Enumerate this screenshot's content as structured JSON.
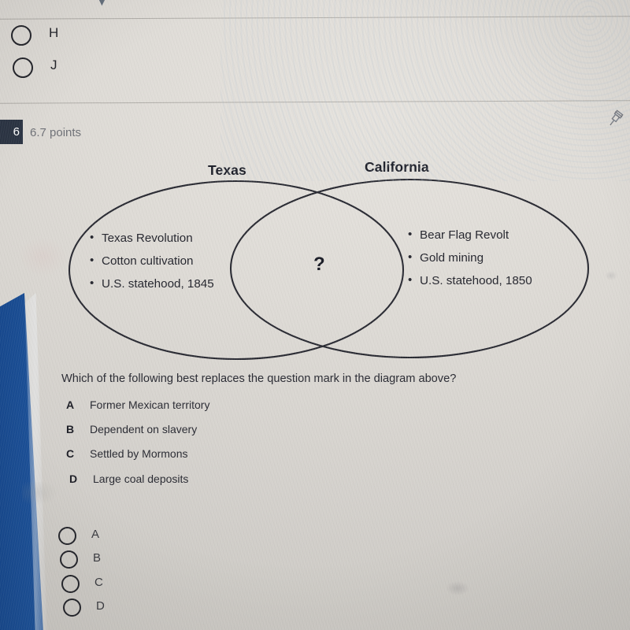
{
  "colors": {
    "page_background": "#d9d6d1",
    "device_edge_blue": "#1d5299",
    "badge_background": "#2b3443",
    "text_primary": "#26272f",
    "text_muted": "#6f7177",
    "diagram_stroke": "#2a2b33"
  },
  "top_question": {
    "options": [
      {
        "label": "H",
        "selected": false
      },
      {
        "label": "J",
        "selected": false
      }
    ]
  },
  "question_header": {
    "number": "6",
    "points": "6.7 points",
    "pin_icon": "pushpin-icon"
  },
  "diagram": {
    "type": "venn",
    "left_circle": {
      "title": "Texas",
      "items": [
        "Texas Revolution",
        "Cotton cultivation",
        "U.S. statehood, 1845"
      ]
    },
    "right_circle": {
      "title": "California",
      "items": [
        "Bear Flag Revolt",
        "Gold mining",
        "U.S. statehood, 1850"
      ]
    },
    "intersection": {
      "label": "?"
    }
  },
  "question": {
    "prompt": "Which of the following best replaces the question mark in the diagram above?",
    "choices": [
      {
        "letter": "A",
        "text": "Former Mexican territory"
      },
      {
        "letter": "B",
        "text": "Dependent on slavery"
      },
      {
        "letter": "C",
        "text": "Settled by Mormons"
      },
      {
        "letter": "D",
        "text": "Large coal deposits"
      }
    ]
  },
  "answer_bubbles": [
    {
      "label": "A",
      "selected": false
    },
    {
      "label": "B",
      "selected": false
    },
    {
      "label": "C",
      "selected": false
    },
    {
      "label": "D",
      "selected": false
    }
  ]
}
